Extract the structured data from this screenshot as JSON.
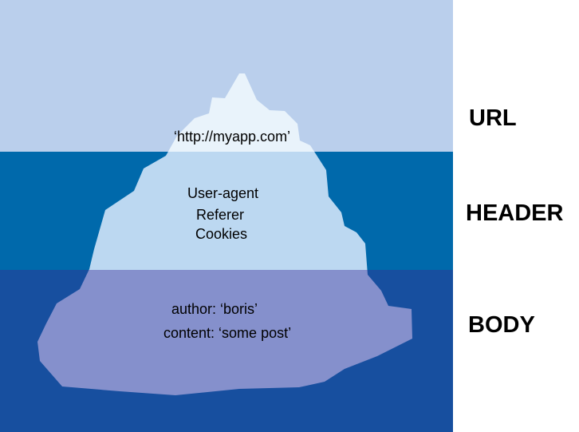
{
  "sections": {
    "url": {
      "label": "URL",
      "items": [
        "‘http://myapp.com’"
      ]
    },
    "header": {
      "label": "HEADER",
      "items": [
        "User-agent",
        "Referer",
        "Cookies"
      ]
    },
    "body": {
      "label": "BODY",
      "items": [
        "author: ‘boris’",
        "content: ‘some post’"
      ]
    }
  },
  "colors": {
    "sky": "#bacfec",
    "water_upper": "#0069ab",
    "water_deep": "#174f9f",
    "ice_above": "#e9f3fb",
    "ice_upper_water": "#bcd8f1",
    "ice_deep_water": "#8590cc"
  }
}
